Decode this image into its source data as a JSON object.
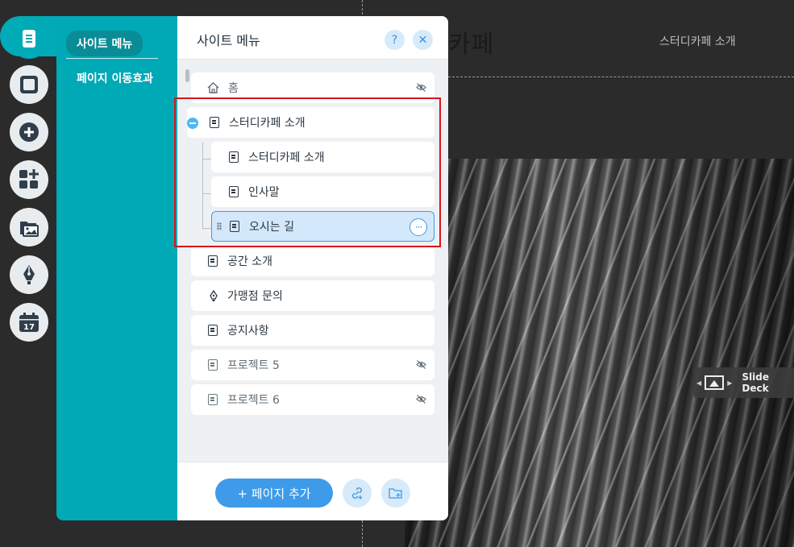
{
  "background": {
    "logo_text": "카페",
    "nav_item": "스터디카페 소개",
    "slide_label": "Slide Deck"
  },
  "toolbar": {
    "tools": [
      {
        "name": "pages-icon",
        "active": true
      },
      {
        "name": "square-icon"
      },
      {
        "name": "plus-circle-icon"
      },
      {
        "name": "apps-add-icon"
      },
      {
        "name": "media-icon"
      },
      {
        "name": "pen-icon"
      },
      {
        "name": "calendar-icon",
        "label": "17"
      }
    ]
  },
  "teal_menu": {
    "active_item": "사이트 메뉴",
    "item": "페이지 이동효과"
  },
  "panel": {
    "title": "사이트 메뉴",
    "help": "?",
    "close": "✕",
    "pages": [
      {
        "label": "홈",
        "icon": "home-icon",
        "hidden": true
      },
      {
        "label": "스터디카페 소개",
        "icon": "page-icon",
        "expanded": true
      },
      {
        "label": "스터디카페 소개",
        "icon": "page-icon",
        "child": true
      },
      {
        "label": "인사말",
        "icon": "page-icon",
        "child": true
      },
      {
        "label": "오시는 길",
        "icon": "page-icon",
        "child": true,
        "selected": true
      },
      {
        "label": "공간 소개",
        "icon": "page-icon"
      },
      {
        "label": "가맹점 문의",
        "icon": "pen-icon"
      },
      {
        "label": "공지사항",
        "icon": "page-icon"
      },
      {
        "label": "프로젝트 5",
        "icon": "page-icon",
        "hidden": true
      },
      {
        "label": "프로젝트 6",
        "icon": "page-icon",
        "hidden": true
      }
    ],
    "more": "···",
    "add_page": "+ 페이지 추가"
  },
  "colors": {
    "teal": "#00a9b6",
    "accent_blue": "#3d9be9",
    "highlight_red": "#d9141a"
  }
}
